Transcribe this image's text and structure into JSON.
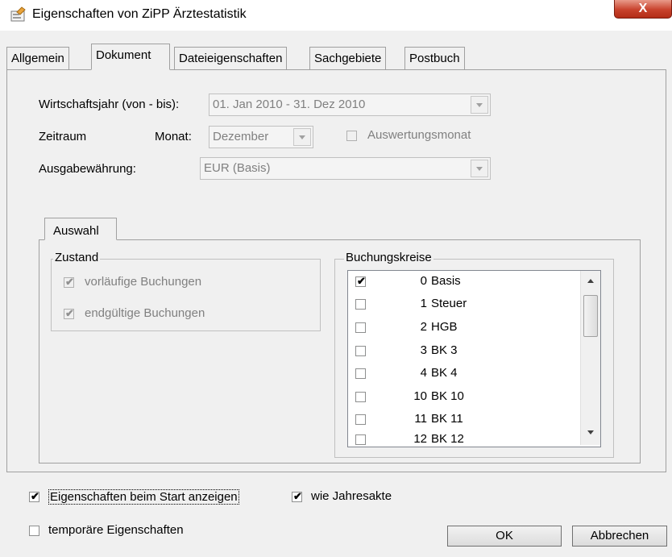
{
  "window": {
    "title": "Eigenschaften von ZiPP Ärztestatistik",
    "close_label": "X"
  },
  "tabs": [
    "Allgemein",
    "Dokument",
    "Dateieigenschaften",
    "Sachgebiete",
    "Postbuch"
  ],
  "form": {
    "fiscal_year_label": "Wirtschaftsjahr (von - bis):",
    "fiscal_year_value": "01. Jan 2010  -  31. Dez 2010",
    "period_label": "Zeitraum",
    "month_label": "Monat:",
    "month_value": "Dezember",
    "evaluation_month_label": "Auswertungsmonat",
    "currency_label": "Ausgabewährung:",
    "currency_value": "EUR (Basis)"
  },
  "inner_tab": {
    "label": "Auswahl"
  },
  "zustand": {
    "title": "Zustand",
    "items": [
      {
        "label": "vorläufige Buchungen",
        "checked": true
      },
      {
        "label": "endgültige Buchungen",
        "checked": true
      }
    ]
  },
  "buchungskreise": {
    "title": "Buchungskreise",
    "items": [
      {
        "num": "0",
        "name": "Basis",
        "checked": true
      },
      {
        "num": "1",
        "name": "Steuer",
        "checked": false
      },
      {
        "num": "2",
        "name": "HGB",
        "checked": false
      },
      {
        "num": "3",
        "name": "BK 3",
        "checked": false
      },
      {
        "num": "4",
        "name": "BK 4",
        "checked": false
      },
      {
        "num": "10",
        "name": "BK 10",
        "checked": false
      },
      {
        "num": "11",
        "name": "BK 11",
        "checked": false
      },
      {
        "num": "12",
        "name": "BK 12",
        "checked": false
      }
    ]
  },
  "footer": {
    "show_at_start": {
      "label": "Eigenschaften beim Start anzeigen",
      "checked": true
    },
    "like_annual_file": {
      "label": "wie Jahresakte",
      "checked": true
    },
    "temporary": {
      "label": "temporäre Eigenschaften",
      "checked": false
    },
    "ok_label": "OK",
    "cancel_label": "Abbrechen"
  },
  "check_glyph": "✔"
}
